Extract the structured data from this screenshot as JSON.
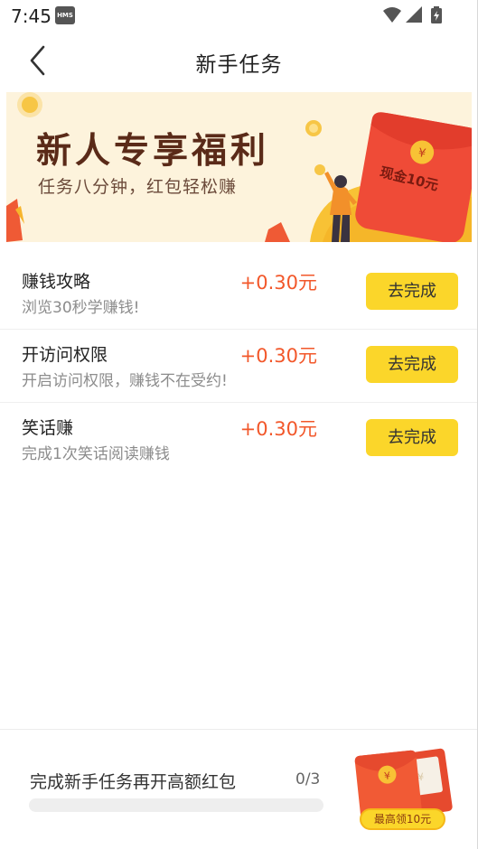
{
  "status_bar": {
    "time": "7:45",
    "hms_badge": "HMS",
    "icons": [
      "wifi-icon",
      "signal-icon",
      "battery-charging-icon"
    ]
  },
  "header": {
    "title": "新手任务",
    "back_icon": "chevron-left-icon"
  },
  "banner": {
    "headline": "新人专享福利",
    "subtitle": "任务八分钟，红包轻松赚",
    "stamp_text": "现金10元",
    "colors": {
      "background": "#fdf3dc",
      "headline": "#5a2a18",
      "envelope": "#ef4b37"
    }
  },
  "tasks": [
    {
      "title": "赚钱攻略",
      "description": "浏览30秒学赚钱!",
      "reward": "+0.30元",
      "button": "去完成"
    },
    {
      "title": "开访问权限",
      "description": "开启访问权限，赚钱不在受约!",
      "reward": "+0.30元",
      "button": "去完成"
    },
    {
      "title": "笑话赚",
      "description": "完成1次笑话阅读赚钱",
      "reward": "+0.30元",
      "button": "去完成"
    }
  ],
  "bottom": {
    "title": "完成新手任务再开高额红包",
    "count": "0/3",
    "progress": 0,
    "promo_label": "最高领10元"
  },
  "colors": {
    "accent": "#fbd62a",
    "reward": "#f2572a"
  }
}
